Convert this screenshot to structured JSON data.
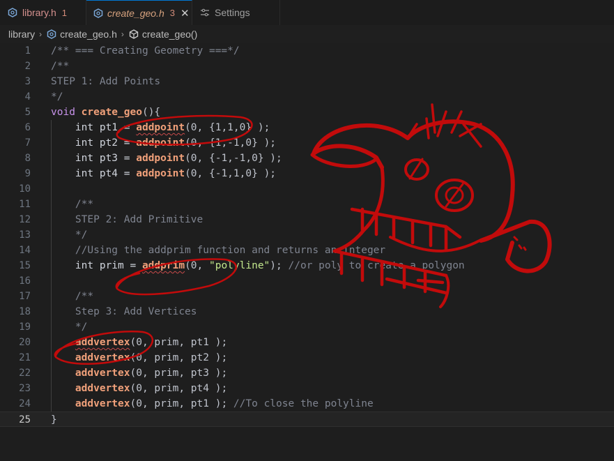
{
  "tabs": [
    {
      "label": "library.h",
      "badge": "1",
      "icon": "gear-file-icon"
    },
    {
      "label": "create_geo.h",
      "badge": "3",
      "close": "✕",
      "icon": "gear-file-icon"
    },
    {
      "label": "Settings",
      "icon": "settings-sliders-icon"
    }
  ],
  "breadcrumb": {
    "items": [
      "library",
      "create_geo.h",
      "create_geo()"
    ],
    "separator": "›"
  },
  "colors": {
    "accent": "#0078d4",
    "annotation_red": "#c20b0b",
    "function": "#f0a07a",
    "comment": "#7f8490",
    "keyword": "#c792ea",
    "string": "#c3e88d"
  },
  "editor": {
    "current_line": "25",
    "line_numbers": [
      "1",
      "2",
      "3",
      "4",
      "5",
      "6",
      "7",
      "8",
      "9",
      "10",
      "11",
      "12",
      "13",
      "14",
      "15",
      "16",
      "17",
      "18",
      "19",
      "20",
      "21",
      "22",
      "23",
      "24",
      "25"
    ],
    "code": {
      "l1": "/** === Creating Geometry ===*/",
      "l2": "/**",
      "l3": "STEP 1: Add Points",
      "l4": "*/",
      "l5_kw": "void",
      "l5_fn": "create_geo",
      "l5_rest": "(){",
      "l6_pre": "int pt1 = ",
      "l6_fn": "addpoint",
      "l6_args": "(0, {1,1,0} );",
      "l7_pre": "int pt2 = ",
      "l7_fn": "addpoint",
      "l7_args": "(0, {1,-1,0} );",
      "l8_pre": "int pt3 = ",
      "l8_fn": "addpoint",
      "l8_args": "(0, {-1,-1,0} );",
      "l9_pre": "int pt4 = ",
      "l9_fn": "addpoint",
      "l9_args": "(0, {-1,1,0} );",
      "l11": "/**",
      "l12": "STEP 2: Add Primitive",
      "l13": "*/",
      "l14": "//Using the addprim function and returns an integer",
      "l15_pre": "int prim = ",
      "l15_fn": "addprim",
      "l15_open": "(0, ",
      "l15_str": "\"polyline\"",
      "l15_close": ");",
      "l15_com": "//or poly to create a polygon",
      "l17": "/**",
      "l18": "Step 3: Add Vertices",
      "l19": "*/",
      "l20_fn": "addvertex",
      "l20_args": "(0, prim, pt1 );",
      "l21_fn": "addvertex",
      "l21_args": "(0, prim, pt2 );",
      "l22_fn": "addvertex",
      "l22_args": "(0, prim, pt3 );",
      "l23_fn": "addvertex",
      "l23_args": "(0, prim, pt4 );",
      "l24_fn": "addvertex",
      "l24_args": "(0, prim, pt1 );",
      "l24_com": "//To close the polyline",
      "l25": "}"
    }
  }
}
